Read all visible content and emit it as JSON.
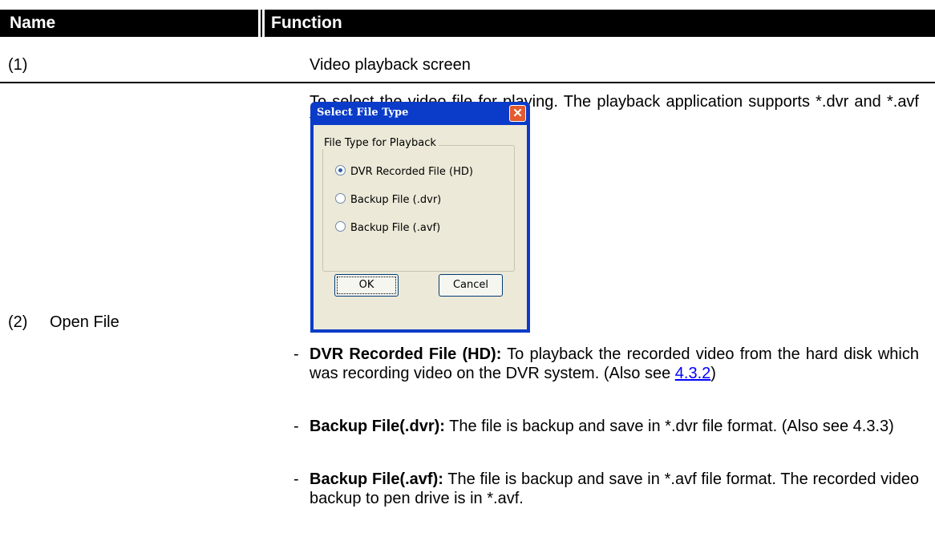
{
  "header": {
    "name": "Name",
    "function": "Function"
  },
  "row1": {
    "number": "(1)",
    "description": "Video playback screen"
  },
  "row2": {
    "number": "(2)",
    "name": "Open File",
    "intro": "To select the video file for playing. The playback application supports *.dvr and *.avf file.",
    "dialog": {
      "title": "Select File Type",
      "close_symbol": "✕",
      "group_label": "File Type for Playback",
      "options": [
        "DVR Recorded File (HD)",
        "Backup File (.dvr)",
        "Backup File (.avf)"
      ],
      "selected_index": 0,
      "ok_label": "OK",
      "cancel_label": "Cancel"
    },
    "bullets": [
      {
        "dash": "-",
        "term": "DVR Recorded File (HD):",
        "text": " To playback the recorded video from the hard disk which was recording video on the DVR system. (Also see ",
        "link": "4.3.2",
        "after": ")"
      },
      {
        "dash": "-",
        "term": "Backup File(.dvr):",
        "text": " The file is backup and save in *.dvr file format. (Also see 4.3.3)"
      },
      {
        "dash": "-",
        "term": "Backup File(.avf):",
        "text": " The file is backup and save in *.avf file format. The recorded video backup to pen drive is in *.avf."
      }
    ]
  }
}
